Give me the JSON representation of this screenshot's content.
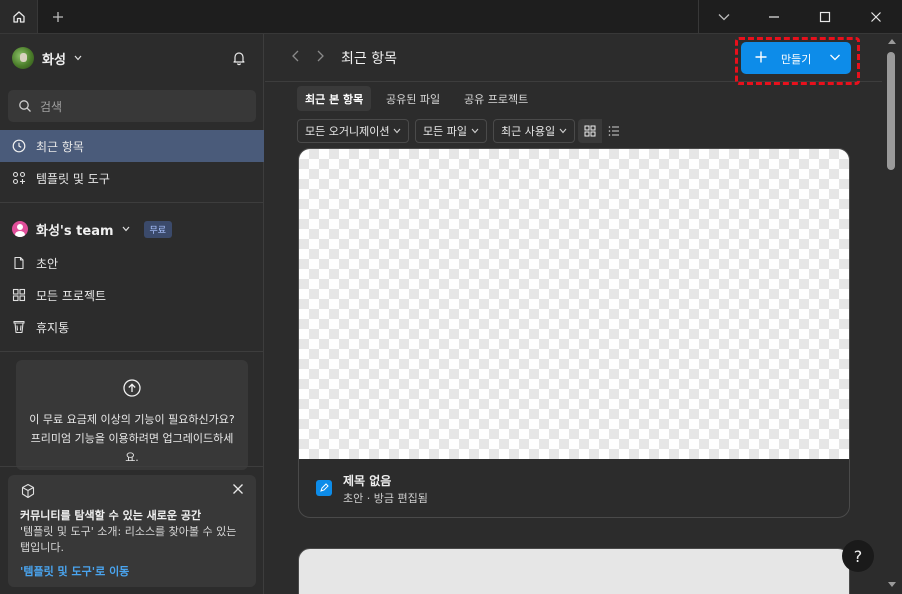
{
  "titlebar": {
    "home_icon": "home-icon",
    "new_tab_icon": "plus-icon"
  },
  "sidebar": {
    "user_name": "화성",
    "search_placeholder": "검색",
    "nav": [
      {
        "label": "최근 항목",
        "icon": "clock-icon",
        "active": true
      },
      {
        "label": "템플릿 및 도구",
        "icon": "templates-icon",
        "active": false
      }
    ],
    "team": {
      "name": "화성's team",
      "badge": "무료",
      "items": [
        {
          "label": "초안",
          "icon": "file-icon"
        },
        {
          "label": "모든 프로젝트",
          "icon": "grid-icon"
        },
        {
          "label": "휴지통",
          "icon": "trash-icon"
        }
      ]
    },
    "promo": {
      "text": "이 무료 요금제 이상의 기능이 필요하신가요? 프리미엄 기능을 이용하려면 업그레이드하세요."
    },
    "notice": {
      "title": "커뮤니티를 탐색할 수 있는 새로운 공간",
      "body": "'템플릿 및 도구' 소개: 리소스를 찾아볼 수 있는 탭입니다.",
      "link": "'템플릿 및 도구'로 이동"
    }
  },
  "main": {
    "title": "최근 항목",
    "create_label": "만들기",
    "tabs": [
      "최근 본 항목",
      "공유된 파일",
      "공유 프로젝트"
    ],
    "filters": [
      "모든 오거니제이션",
      "모든 파일",
      "최근 사용일"
    ],
    "card": {
      "title": "제목 없음",
      "meta": "초안 · 방금 편집됨"
    }
  },
  "help_label": "?",
  "colors": {
    "accent": "#0d8ce9",
    "active_nav": "#4a5b7a",
    "highlight_outline": "#e8101c"
  }
}
